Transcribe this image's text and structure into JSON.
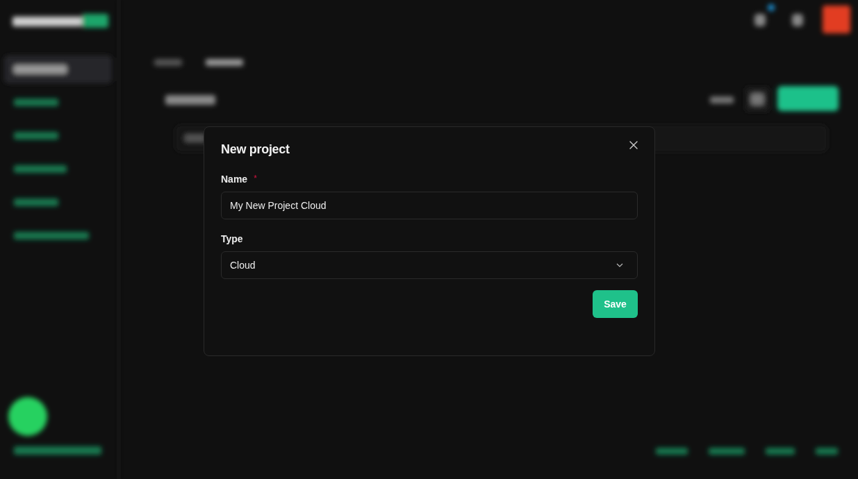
{
  "dialog": {
    "title": "New project",
    "fields": [
      {
        "kind": "text",
        "label": "Name",
        "required_mark": "*",
        "value": "My New Project Cloud"
      },
      {
        "kind": "select",
        "label": "Type",
        "value": "Cloud"
      }
    ],
    "save_button": "Save"
  }
}
